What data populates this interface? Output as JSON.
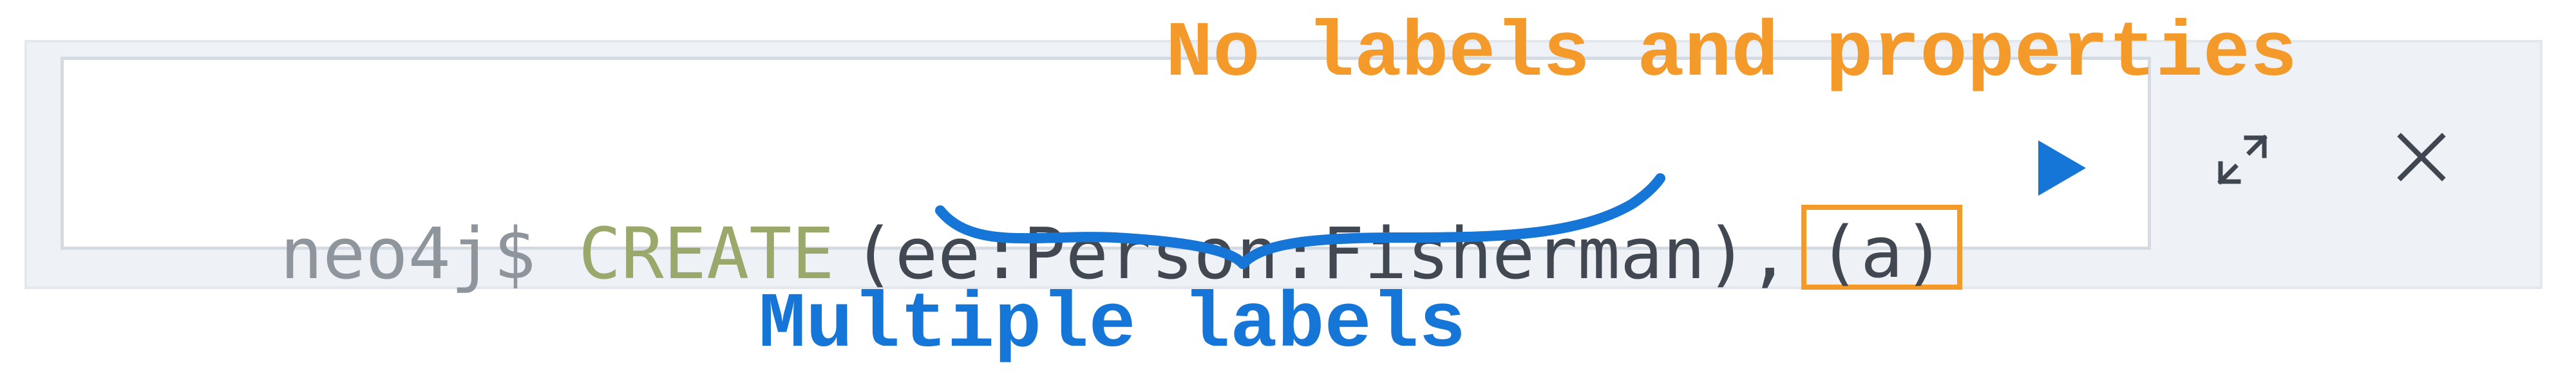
{
  "annotations": {
    "top_note": "No labels and properties",
    "bottom_note": "Multiple labels"
  },
  "editor": {
    "prompt": "neo4j$",
    "keyword": "CREATE",
    "query_open": "(ee:",
    "label_one": "Person",
    "label_sep": ":",
    "label_two": "Fisherman",
    "query_close": "),",
    "highlighted_node": "(a)"
  },
  "toolbar": {
    "play_icon": "play-icon",
    "expand_icon": "expand-icon",
    "close_icon": "close-icon"
  },
  "colors": {
    "orange_annotation": "#f39a2b",
    "blue_annotation": "#1576d8",
    "keyword": "#9aa96b",
    "prompt": "#8f959c",
    "play": "#1576d8"
  }
}
